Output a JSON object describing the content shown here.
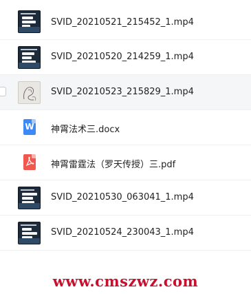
{
  "files": [
    {
      "name": "SVID_20210521_215452_1.mp4",
      "type": "video"
    },
    {
      "name": "SVID_20210520_214259_1.mp4",
      "type": "video"
    },
    {
      "name": "SVID_20210523_215829_1.mp4",
      "type": "video-sketch",
      "hovered": true
    },
    {
      "name": "神霄法术三.docx",
      "type": "docx"
    },
    {
      "name": "神霄雷霆法（罗天传授）三.pdf",
      "type": "pdf"
    },
    {
      "name": "SVID_20210530_063041_1.mp4",
      "type": "video"
    },
    {
      "name": "SVID_20210524_230043_1.mp4",
      "type": "video"
    }
  ],
  "icons": {
    "docx": "W",
    "pdf": "pdf-icon"
  },
  "watermark": "www.cmszwz.com",
  "colors": {
    "docx": "#3d8af7",
    "pdf": "#f0574e",
    "watermark": "#c8102e",
    "hover_bg": "#f5f6f8"
  }
}
